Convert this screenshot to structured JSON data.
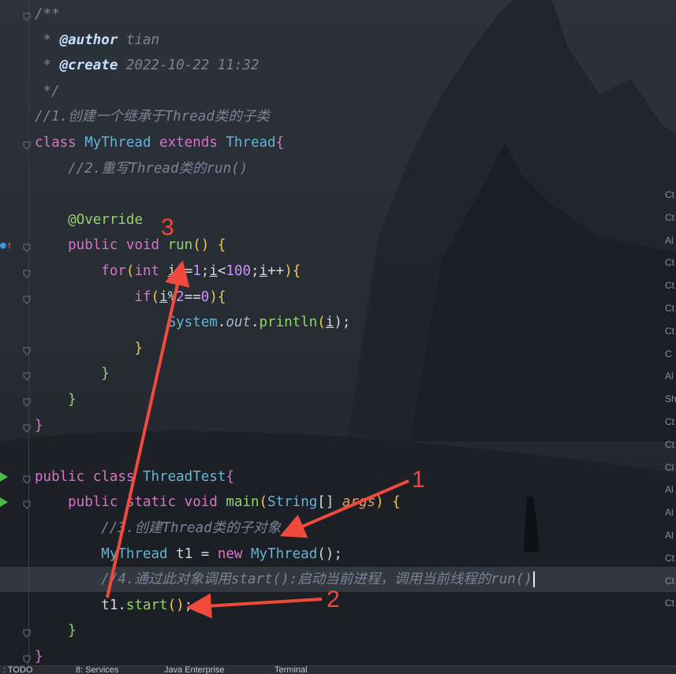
{
  "editor": {
    "lines": [
      [
        {
          "t": "/**",
          "c": "c-comment"
        }
      ],
      [
        {
          "t": " * ",
          "c": "c-comment"
        },
        {
          "t": "@author",
          "c": "c-doctag"
        },
        {
          "t": " tian",
          "c": "c-comment"
        }
      ],
      [
        {
          "t": " * ",
          "c": "c-comment"
        },
        {
          "t": "@create",
          "c": "c-doctag"
        },
        {
          "t": " 2022-10-22 11:32",
          "c": "c-comment"
        }
      ],
      [
        {
          "t": " */",
          "c": "c-comment"
        }
      ],
      [
        {
          "t": "//1.创建一个继承于Thread类的子类",
          "c": "c-comment"
        }
      ],
      [
        {
          "t": "class ",
          "c": "c-keyword"
        },
        {
          "t": "MyThread ",
          "c": "c-class"
        },
        {
          "t": "extends ",
          "c": "c-keyword"
        },
        {
          "t": "Thread",
          "c": "c-class"
        },
        {
          "t": "{",
          "c": "c-keyword"
        }
      ],
      [
        {
          "t": "    //2.重写Thread类的run()",
          "c": "c-comment"
        }
      ],
      [],
      [
        {
          "t": "    ",
          "c": "c-plain"
        },
        {
          "t": "@Override",
          "c": "c-annot"
        }
      ],
      [
        {
          "t": "    public ",
          "c": "c-keyword"
        },
        {
          "t": "void ",
          "c": "c-keyword"
        },
        {
          "t": "run",
          "c": "c-fn"
        },
        {
          "t": "() {",
          "c": "c-paren"
        }
      ],
      [
        {
          "t": "        for",
          "c": "c-keyword"
        },
        {
          "t": "(",
          "c": "c-paren"
        },
        {
          "t": "int ",
          "c": "c-keyword"
        },
        {
          "t": "i",
          "c": "c-var"
        },
        {
          "t": " =",
          "c": "c-plain"
        },
        {
          "t": "1",
          "c": "c-num"
        },
        {
          "t": ";",
          "c": "c-plain"
        },
        {
          "t": "i",
          "c": "c-var"
        },
        {
          "t": "<",
          "c": "c-plain"
        },
        {
          "t": "100",
          "c": "c-num"
        },
        {
          "t": ";",
          "c": "c-plain"
        },
        {
          "t": "i",
          "c": "c-var"
        },
        {
          "t": "++",
          "c": "c-plain"
        },
        {
          "t": "){",
          "c": "c-paren"
        }
      ],
      [
        {
          "t": "            if",
          "c": "c-keyword"
        },
        {
          "t": "(",
          "c": "c-paren"
        },
        {
          "t": "i",
          "c": "c-var"
        },
        {
          "t": "%",
          "c": "c-plain"
        },
        {
          "t": "2",
          "c": "c-num"
        },
        {
          "t": "==",
          "c": "c-plain"
        },
        {
          "t": "0",
          "c": "c-num"
        },
        {
          "t": "){",
          "c": "c-paren"
        }
      ],
      [
        {
          "t": "                System",
          "c": "c-class"
        },
        {
          "t": ".",
          "c": "c-plain"
        },
        {
          "t": "out",
          "c": "c-field"
        },
        {
          "t": ".",
          "c": "c-plain"
        },
        {
          "t": "println",
          "c": "c-fn"
        },
        {
          "t": "(",
          "c": "c-paren"
        },
        {
          "t": "i",
          "c": "c-var"
        },
        {
          "t": ");",
          "c": "c-plain"
        }
      ],
      [
        {
          "t": "            }",
          "c": "c-paren"
        }
      ],
      [
        {
          "t": "        }",
          "c": "c-fn"
        }
      ],
      [
        {
          "t": "    }",
          "c": "c-fn"
        }
      ],
      [
        {
          "t": "}",
          "c": "c-keyword"
        }
      ],
      [],
      [
        {
          "t": "public ",
          "c": "c-keyword"
        },
        {
          "t": "class ",
          "c": "c-keyword"
        },
        {
          "t": "ThreadTest",
          "c": "c-class"
        },
        {
          "t": "{",
          "c": "c-keyword"
        }
      ],
      [
        {
          "t": "    public ",
          "c": "c-keyword"
        },
        {
          "t": "static ",
          "c": "c-keyword"
        },
        {
          "t": "void ",
          "c": "c-keyword"
        },
        {
          "t": "main",
          "c": "c-fn"
        },
        {
          "t": "(",
          "c": "c-paren"
        },
        {
          "t": "String",
          "c": "c-class"
        },
        {
          "t": "[] ",
          "c": "c-plain"
        },
        {
          "t": "args",
          "c": "c-param"
        },
        {
          "t": ") {",
          "c": "c-paren"
        }
      ],
      [
        {
          "t": "        //3.创建Thread类的子对象",
          "c": "c-comment"
        }
      ],
      [
        {
          "t": "        MyThread ",
          "c": "c-class"
        },
        {
          "t": "t1 = ",
          "c": "c-plain"
        },
        {
          "t": "new ",
          "c": "c-keyword"
        },
        {
          "t": "MyThread",
          "c": "c-class"
        },
        {
          "t": "();",
          "c": "c-plain"
        }
      ],
      [
        {
          "t": "        //4.通过此对象调用start():启动当前进程，调用当前线程的run()",
          "c": "c-comment"
        }
      ],
      [
        {
          "t": "        t1.",
          "c": "c-plain"
        },
        {
          "t": "start",
          "c": "c-fn"
        },
        {
          "t": "()",
          "c": "c-paren"
        },
        {
          "t": ";",
          "c": "c-plain"
        }
      ],
      [
        {
          "t": "    }",
          "c": "c-fn"
        }
      ],
      [
        {
          "t": "}",
          "c": "c-keyword"
        }
      ]
    ],
    "cursor_line": 22,
    "run_lines": [
      18,
      19
    ],
    "override_line": 9,
    "override_icon": "override-method-icon"
  },
  "annotations": [
    "1",
    "2",
    "3"
  ],
  "right_panel": [
    "Ct",
    "Ct",
    "Al",
    "Ct",
    "Ct",
    "Ct",
    "Ct",
    "C",
    "Al",
    "Sh",
    "Ct",
    "Ct",
    "Cl",
    "Al",
    "Al",
    "Al",
    "Ct",
    "Ct",
    "Ct"
  ],
  "status_bar": {
    "todo": ": TODO",
    "services": "8: Services",
    "java_enterprise": "Java Enterprise",
    "terminal": "Terminal"
  },
  "colors": {
    "background": "#22262d",
    "arrow": "#f04a3c",
    "run_marker": "#4cbb4c"
  }
}
